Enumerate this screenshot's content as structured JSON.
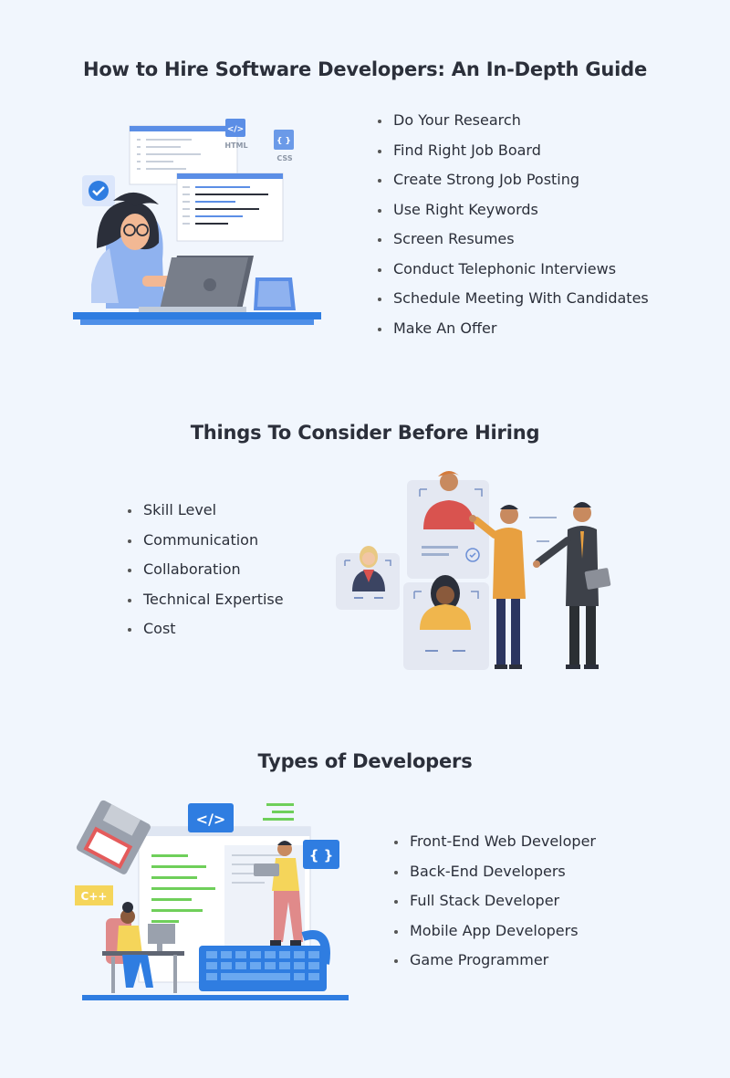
{
  "sections": [
    {
      "title": "How to Hire Software Developers: An In-Depth Guide",
      "items": [
        "Do Your Research",
        "Find Right Job Board",
        "Create Strong Job Posting",
        "Use Right Keywords",
        "Screen Resumes",
        "Conduct Telephonic Interviews",
        "Schedule Meeting With Candidates",
        "Make An Offer"
      ],
      "illustration": {
        "labels": {
          "html": "HTML",
          "css": "CSS",
          "html_tag": "</>",
          "css_tag": "{ }"
        }
      }
    },
    {
      "title": "Things To Consider Before Hiring",
      "items": [
        "Skill Level",
        "Communication",
        "Collaboration",
        "Technical Expertise",
        "Cost"
      ]
    },
    {
      "title": "Types of Developers",
      "items": [
        "Front-End Web Developer",
        "Back-End Developers",
        "Full Stack Developer",
        "Mobile App Developers",
        "Game Programmer"
      ],
      "illustration": {
        "labels": {
          "code_tag": "</>",
          "braces": "{ }",
          "cpp": "C++"
        }
      }
    }
  ],
  "colors": {
    "background": "#f1f6fd",
    "accent": "#2f7de1",
    "title": "#2b2f3a"
  }
}
